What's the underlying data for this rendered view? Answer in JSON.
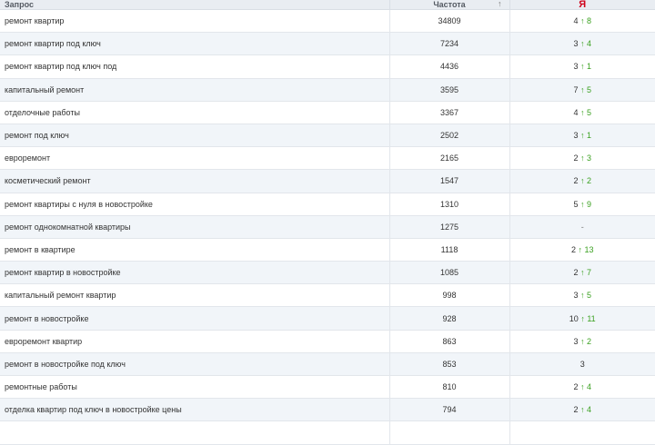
{
  "header": {
    "query": "Запрос",
    "frequency": "Частота",
    "sort_icon": "↑",
    "engine": "Я"
  },
  "rows": [
    {
      "query": "ремонт квартир",
      "freq": "34809",
      "pos": "4",
      "arrow": "↑",
      "delta": "8"
    },
    {
      "query": "ремонт квартир под ключ",
      "freq": "7234",
      "pos": "3",
      "arrow": "↑",
      "delta": "4"
    },
    {
      "query": "ремонт квартир под ключ под",
      "freq": "4436",
      "pos": "3",
      "arrow": "↑",
      "delta": "1"
    },
    {
      "query": "капитальный ремонт",
      "freq": "3595",
      "pos": "7",
      "arrow": "↑",
      "delta": "5"
    },
    {
      "query": "отделочные работы",
      "freq": "3367",
      "pos": "4",
      "arrow": "↑",
      "delta": "5"
    },
    {
      "query": "ремонт под ключ",
      "freq": "2502",
      "pos": "3",
      "arrow": "↑",
      "delta": "1"
    },
    {
      "query": "евроремонт",
      "freq": "2165",
      "pos": "2",
      "arrow": "↑",
      "delta": "3"
    },
    {
      "query": "косметический ремонт",
      "freq": "1547",
      "pos": "2",
      "arrow": "↑",
      "delta": "2"
    },
    {
      "query": "ремонт квартиры с нуля в новостройке",
      "freq": "1310",
      "pos": "5",
      "arrow": "↑",
      "delta": "9"
    },
    {
      "query": "ремонт однокомнатной квартиры",
      "freq": "1275",
      "pos": "-",
      "arrow": "",
      "delta": ""
    },
    {
      "query": "ремонт в квартире",
      "freq": "1118",
      "pos": "2",
      "arrow": "↑",
      "delta": "13"
    },
    {
      "query": "ремонт квартир в новостройке",
      "freq": "1085",
      "pos": "2",
      "arrow": "↑",
      "delta": "7"
    },
    {
      "query": "капитальный ремонт квартир",
      "freq": "998",
      "pos": "3",
      "arrow": "↑",
      "delta": "5"
    },
    {
      "query": "ремонт в новостройке",
      "freq": "928",
      "pos": "10",
      "arrow": "↑",
      "delta": "11"
    },
    {
      "query": "евроремонт квартир",
      "freq": "863",
      "pos": "3",
      "arrow": "↑",
      "delta": "2"
    },
    {
      "query": "ремонт в новостройке под ключ",
      "freq": "853",
      "pos": "3",
      "arrow": "",
      "delta": ""
    },
    {
      "query": "ремонтные работы",
      "freq": "810",
      "pos": "2",
      "arrow": "↑",
      "delta": "4"
    },
    {
      "query": "отделка квартир под ключ в новостройке цены",
      "freq": "794",
      "pos": "2",
      "arrow": "↑",
      "delta": "4"
    },
    {
      "query": "",
      "freq": "",
      "pos": "",
      "arrow": "",
      "delta": ""
    }
  ]
}
